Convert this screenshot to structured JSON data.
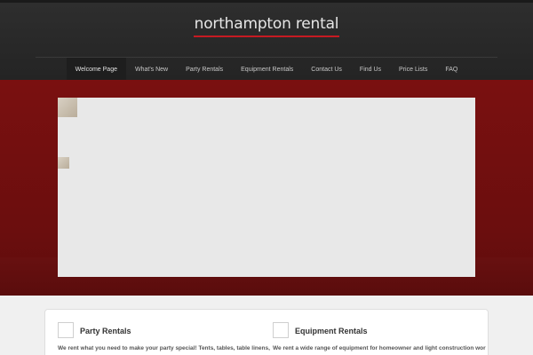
{
  "site": {
    "logo_text": "northampton rental"
  },
  "nav": {
    "items": [
      {
        "label": "Welcome Page"
      },
      {
        "label": "What's New"
      },
      {
        "label": "Party Rentals"
      },
      {
        "label": "Equipment Rentals"
      },
      {
        "label": "Contact Us"
      },
      {
        "label": "Find Us"
      },
      {
        "label": "Price Lists"
      },
      {
        "label": "FAQ"
      }
    ],
    "active_index": 0
  },
  "colors": {
    "header_bg": "#2a2a2a",
    "hero_red": "#6b0e0e",
    "accent_red": "#c61a22"
  },
  "features": [
    {
      "icon": "party-icon",
      "title": "Party Rentals",
      "text": "We rent what you need to make your party special! Tents, tables, table linens, dishes, flatware, glassware and much more"
    },
    {
      "icon": "equipment-icon",
      "title": "Equipment Rentals",
      "text": "We rent a wide range of equipment for homeowner and light construction work. Our tools are kept clean and sharp"
    }
  ]
}
